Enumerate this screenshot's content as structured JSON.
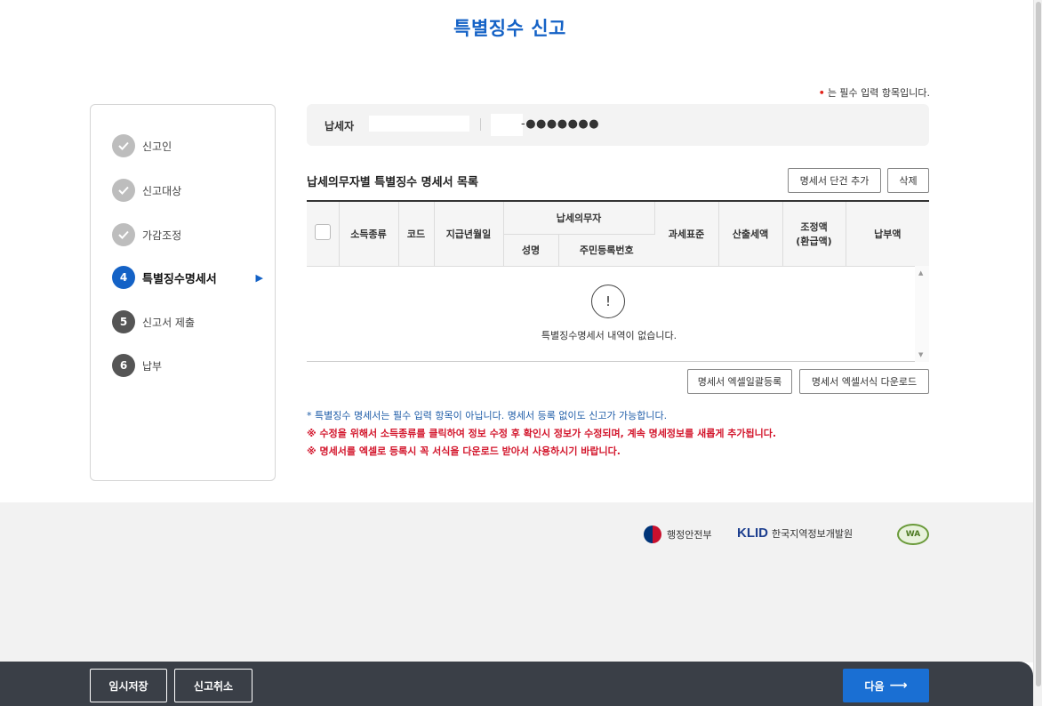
{
  "page": {
    "title": "특별징수 신고",
    "required_note": "는 필수 입력 항목입니다.",
    "required_dot": "•"
  },
  "steps": [
    {
      "number": "",
      "label": "신고인",
      "state": "done"
    },
    {
      "number": "",
      "label": "신고대상",
      "state": "done"
    },
    {
      "number": "",
      "label": "가감조정",
      "state": "done"
    },
    {
      "number": "4",
      "label": "특별징수명세서",
      "state": "current"
    },
    {
      "number": "5",
      "label": "신고서 제출",
      "state": "todo"
    },
    {
      "number": "6",
      "label": "납부",
      "state": "todo"
    }
  ],
  "taxpayer": {
    "label": "납세자",
    "id_masked": "-●●●●●●●"
  },
  "section": {
    "title": "납세의무자별 특별징수 명세서 목록",
    "add_button": "명세서 단건 추가",
    "delete_button": "삭제"
  },
  "table": {
    "headers": {
      "income_type": "소득종류",
      "code": "코드",
      "pay_date": "지급년월일",
      "taxpayer_group": "납세의무자",
      "name": "성명",
      "rrn": "주민등록번호",
      "tax_base": "과세표준",
      "calc_tax": "산출세액",
      "adjust": "조정액",
      "adjust_sub": "(환급액)",
      "pay_amount": "납부액"
    },
    "empty_icon": "!",
    "empty_message": "특별징수명세서 내역이 없습니다."
  },
  "excel": {
    "upload_button": "명세서 엑셀일괄등록",
    "download_button": "명세서 엑셀서식 다운로드"
  },
  "notes": {
    "info": "* 특별징수 명세서는 필수 입력 항목이 아닙니다. 명세서 등록 없이도 신고가 가능합니다.",
    "warn1": "※ 수정을 위해서 소득종류를 클릭하여 정보 수정 후 확인시 정보가 수정되며, 계속 명세정보를 새롭게 추가됩니다.",
    "warn2": "※ 명세서를 엑셀로 등록시 꼭 서식을 다운로드 받아서 사용하시기 바랍니다."
  },
  "footer": {
    "logo1": "행정안전부",
    "logo2_mark": "KLID",
    "logo2_text": "한국지역정보개발원",
    "logo3": "WA"
  },
  "bottom": {
    "save_temp": "임시저장",
    "cancel": "신고취소",
    "next": "다음",
    "next_arrow": "⟶"
  },
  "colors": {
    "accent": "#1462c6",
    "warning": "#d3162c",
    "bottom_bar": "#3a3f47"
  }
}
